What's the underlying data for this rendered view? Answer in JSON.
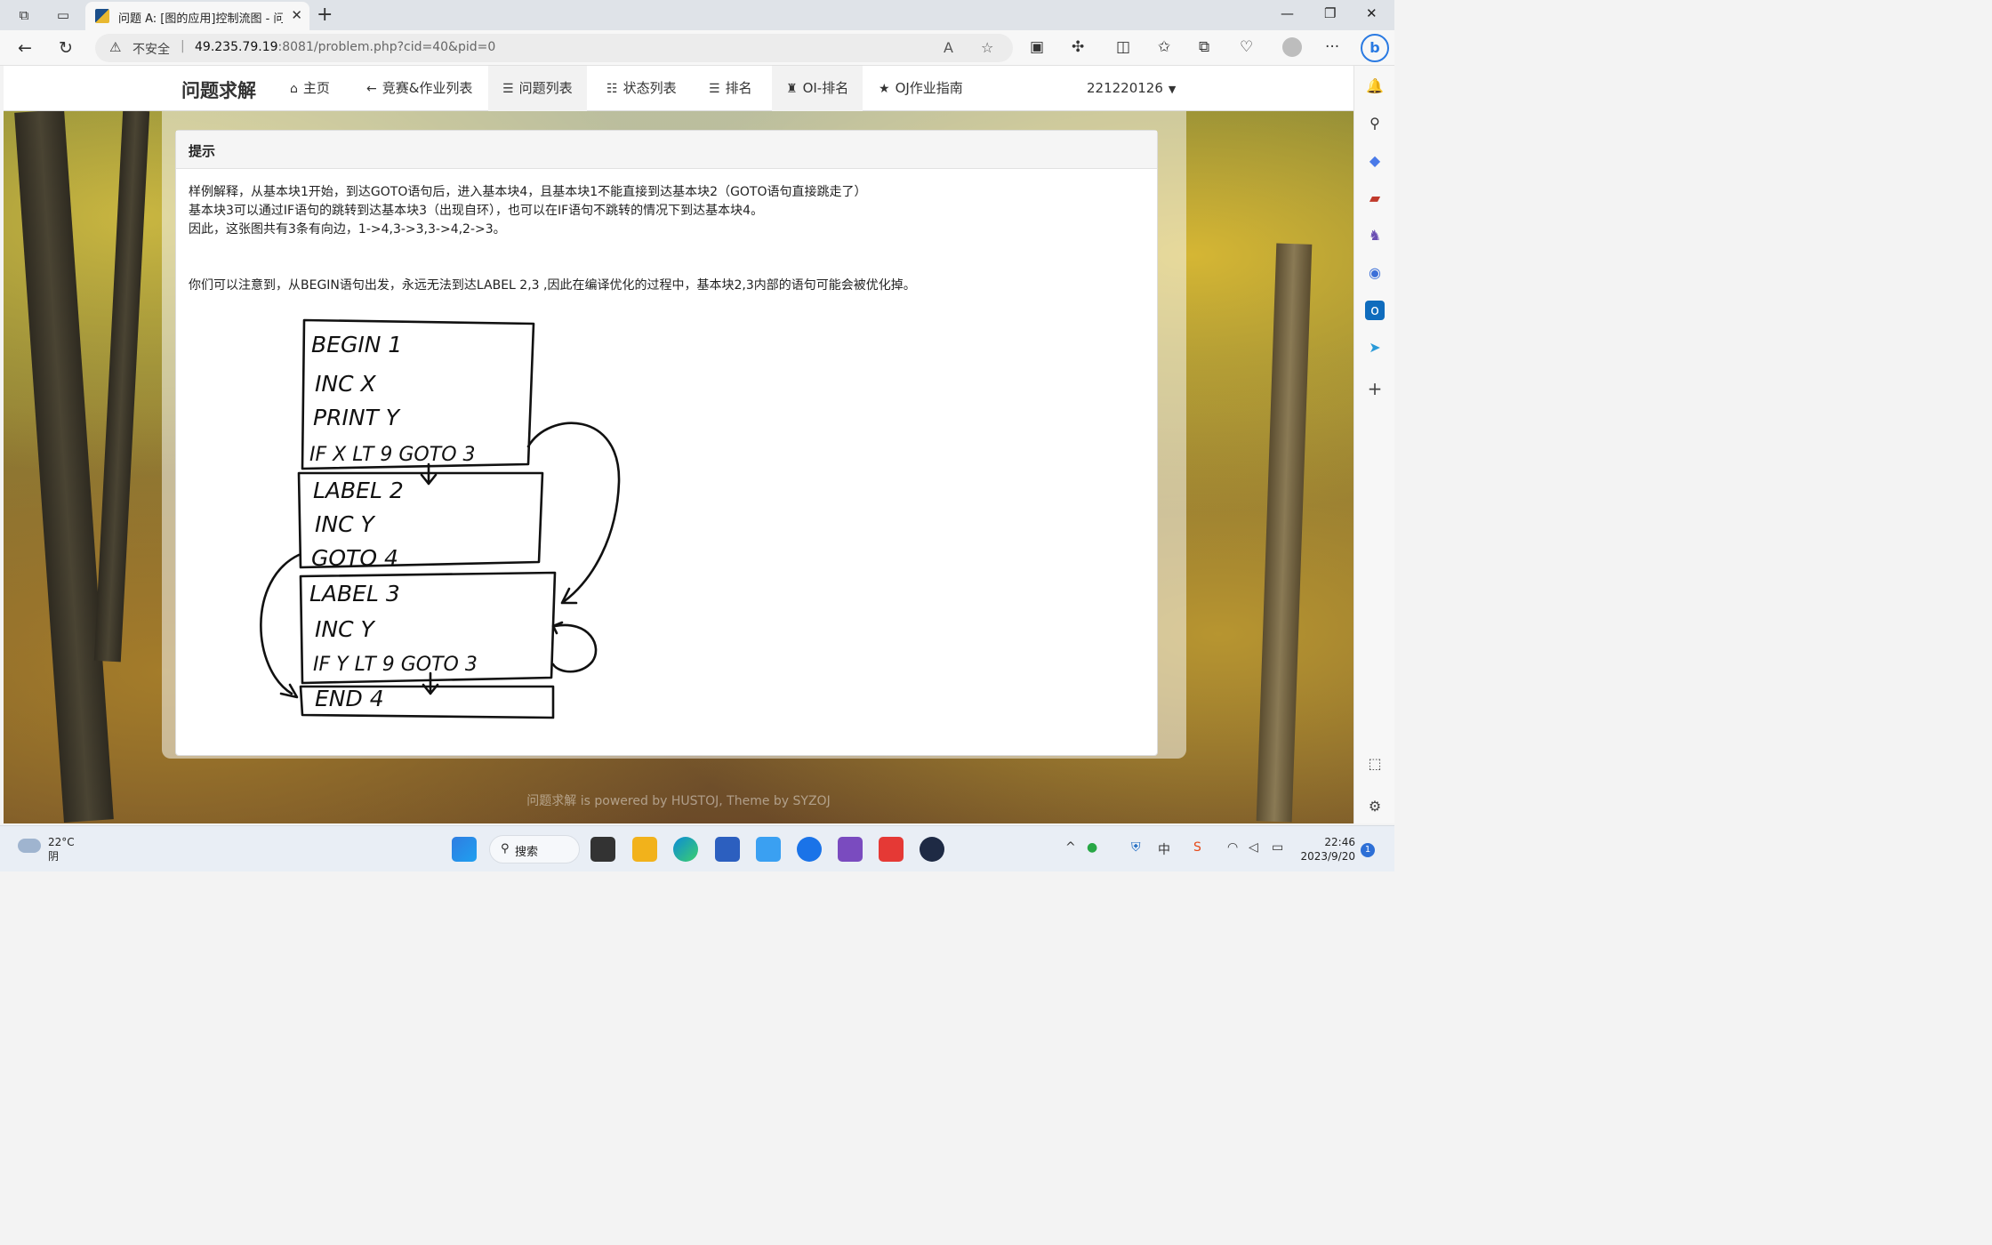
{
  "browser": {
    "tab_title": "问题 A: [图的应用]控制流图 - 问题",
    "security_label": "不安全",
    "url_host": "49.235.79.19",
    "url_rest": ":8081/problem.php?cid=40&pid=0"
  },
  "site": {
    "brand": "问题求解",
    "nav": [
      {
        "label": "主页",
        "icon": "home-icon"
      },
      {
        "label": "竞赛&作业列表",
        "icon": "arrow-left-icon"
      },
      {
        "label": "问题列表",
        "icon": "list-icon"
      },
      {
        "label": "状态列表",
        "icon": "checklist-icon"
      },
      {
        "label": "排名",
        "icon": "list-icon"
      },
      {
        "label": "OI-排名",
        "icon": "person-icon"
      },
      {
        "label": "OJ作业指南",
        "icon": "star-icon"
      }
    ],
    "user": "221220126"
  },
  "panel": {
    "title": "提示",
    "lines": [
      "样例解释，从基本块1开始，到达GOTO语句后，进入基本块4，且基本块1不能直接到达基本块2（GOTO语句直接跳走了）",
      "基本块3可以通过IF语句的跳转到达基本块3（出现自环），也可以在IF语句不跳转的情况下到达基本块4。",
      "因此，这张图共有3条有向边，1->4,3->3,3->4,2->3。",
      "你们可以注意到，从BEGIN语句出发，永远无法到达LABEL 2,3 ,因此在编译优化的过程中，基本块2,3内部的语句可能会被优化掉。"
    ],
    "sketch": {
      "block1": [
        "BEGIN  1",
        "INC   X",
        "PRINT  Y",
        "IF  X  LT 9   GOTO 3"
      ],
      "block2": [
        "LABEL  2",
        "INC   Y",
        "GOTO  4"
      ],
      "block3": [
        "LABEL 3",
        "INC  Y",
        "IF  Y  LT 9   GOTO 3"
      ],
      "block4": [
        "END  4"
      ]
    }
  },
  "footer": "问题求解 is powered by HUSTOJ, Theme by SYZOJ",
  "taskbar": {
    "temp": "22°C",
    "weather": "阴",
    "search": "搜索",
    "ime": "中",
    "time": "22:46",
    "date": "2023/9/20",
    "notifications": "1"
  }
}
